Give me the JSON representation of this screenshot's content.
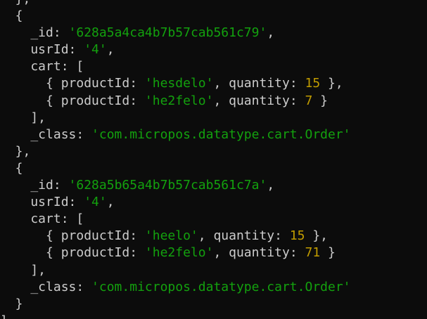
{
  "lines": [
    [
      {
        "t": "p",
        "v": "  },"
      }
    ],
    [
      {
        "t": "p",
        "v": "  {"
      }
    ],
    [
      {
        "t": "p",
        "v": "    _id: "
      },
      {
        "t": "s",
        "v": "'628a5a4ca4b7b57cab561c79'"
      },
      {
        "t": "p",
        "v": ","
      }
    ],
    [
      {
        "t": "p",
        "v": "    usrId: "
      },
      {
        "t": "s",
        "v": "'4'"
      },
      {
        "t": "p",
        "v": ","
      }
    ],
    [
      {
        "t": "p",
        "v": "    cart: ["
      }
    ],
    [
      {
        "t": "p",
        "v": "      { productId: "
      },
      {
        "t": "s",
        "v": "'hesdelo'"
      },
      {
        "t": "p",
        "v": ", quantity: "
      },
      {
        "t": "n",
        "v": "15"
      },
      {
        "t": "p",
        "v": " },"
      }
    ],
    [
      {
        "t": "p",
        "v": "      { productId: "
      },
      {
        "t": "s",
        "v": "'he2felo'"
      },
      {
        "t": "p",
        "v": ", quantity: "
      },
      {
        "t": "n",
        "v": "7"
      },
      {
        "t": "p",
        "v": " }"
      }
    ],
    [
      {
        "t": "p",
        "v": "    ],"
      }
    ],
    [
      {
        "t": "p",
        "v": "    _class: "
      },
      {
        "t": "s",
        "v": "'com.micropos.datatype.cart.Order'"
      }
    ],
    [
      {
        "t": "p",
        "v": "  },"
      }
    ],
    [
      {
        "t": "p",
        "v": "  {"
      }
    ],
    [
      {
        "t": "p",
        "v": "    _id: "
      },
      {
        "t": "s",
        "v": "'628a5b65a4b7b57cab561c7a'"
      },
      {
        "t": "p",
        "v": ","
      }
    ],
    [
      {
        "t": "p",
        "v": "    usrId: "
      },
      {
        "t": "s",
        "v": "'4'"
      },
      {
        "t": "p",
        "v": ","
      }
    ],
    [
      {
        "t": "p",
        "v": "    cart: ["
      }
    ],
    [
      {
        "t": "p",
        "v": "      { productId: "
      },
      {
        "t": "s",
        "v": "'heelo'"
      },
      {
        "t": "p",
        "v": ", quantity: "
      },
      {
        "t": "n",
        "v": "15"
      },
      {
        "t": "p",
        "v": " },"
      }
    ],
    [
      {
        "t": "p",
        "v": "      { productId: "
      },
      {
        "t": "s",
        "v": "'he2felo'"
      },
      {
        "t": "p",
        "v": ", quantity: "
      },
      {
        "t": "n",
        "v": "71"
      },
      {
        "t": "p",
        "v": " }"
      }
    ],
    [
      {
        "t": "p",
        "v": "    ],"
      }
    ],
    [
      {
        "t": "p",
        "v": "    _class: "
      },
      {
        "t": "s",
        "v": "'com.micropos.datatype.cart.Order'"
      }
    ],
    [
      {
        "t": "p",
        "v": "  }"
      }
    ],
    [
      {
        "t": "p",
        "v": "]"
      }
    ]
  ],
  "colors": {
    "background": "#0c0c0c",
    "text": "#cccccc",
    "string": "#13a10e",
    "number": "#c19c00"
  }
}
